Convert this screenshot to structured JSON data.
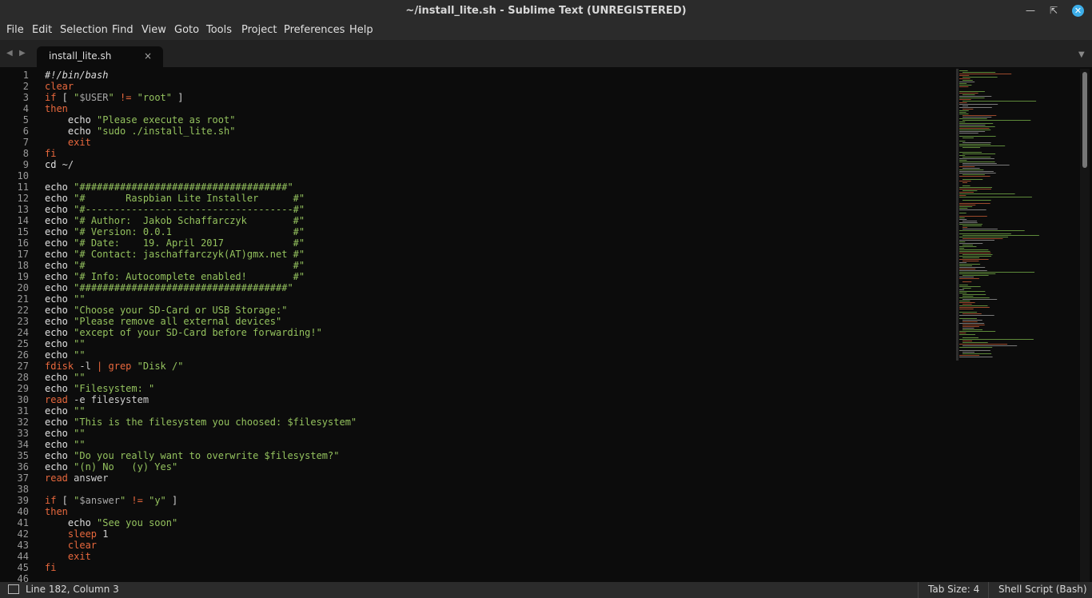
{
  "window": {
    "title": "~/install_lite.sh - Sublime Text (UNREGISTERED)",
    "minimize_icon": "minimize-icon",
    "restore_icon": "restore-icon",
    "close_icon": "close-icon"
  },
  "menu": [
    "File",
    "Edit",
    "Selection",
    "Find",
    "View",
    "Goto",
    "Tools",
    "Project",
    "Preferences",
    "Help"
  ],
  "tab": {
    "filename": "install_lite.sh",
    "close": "×"
  },
  "status": {
    "position": "Line 182, Column 3",
    "tab_size": "Tab Size: 4",
    "syntax": "Shell Script (Bash)"
  },
  "colors": {
    "keyword": "#e8683d",
    "string": "#94c25e",
    "background": "#0c0c0c",
    "chrome": "#2b2b2b",
    "accent": "#3daee9"
  },
  "code": [
    [
      [
        "i",
        "#!/bin/bash"
      ]
    ],
    [
      [
        "k",
        "clear"
      ]
    ],
    [
      [
        "k",
        "if"
      ],
      [
        "c",
        " [ "
      ],
      [
        "s",
        "\""
      ],
      [
        "v",
        "$USER"
      ],
      [
        "s",
        "\""
      ],
      [
        "c",
        " "
      ],
      [
        "k",
        "!="
      ],
      [
        "c",
        " "
      ],
      [
        "s",
        "\"root\""
      ],
      [
        "c",
        " ]"
      ]
    ],
    [
      [
        "k",
        "then"
      ]
    ],
    [
      [
        "c",
        "    "
      ],
      [
        "p",
        "echo"
      ],
      [
        "c",
        " "
      ],
      [
        "s",
        "\"Please execute as root\""
      ]
    ],
    [
      [
        "c",
        "    "
      ],
      [
        "p",
        "echo"
      ],
      [
        "c",
        " "
      ],
      [
        "s",
        "\"sudo ./install_lite.sh\""
      ]
    ],
    [
      [
        "c",
        "    "
      ],
      [
        "k",
        "exit"
      ]
    ],
    [
      [
        "k",
        "fi"
      ]
    ],
    [
      [
        "p",
        "cd"
      ],
      [
        "c",
        " ~/"
      ]
    ],
    [],
    [
      [
        "p",
        "echo"
      ],
      [
        "c",
        " "
      ],
      [
        "s",
        "\"####################################\""
      ]
    ],
    [
      [
        "p",
        "echo"
      ],
      [
        "c",
        " "
      ],
      [
        "s",
        "\"#       Raspbian Lite Installer      #\""
      ]
    ],
    [
      [
        "p",
        "echo"
      ],
      [
        "c",
        " "
      ],
      [
        "s",
        "\"#------------------------------------#\""
      ]
    ],
    [
      [
        "p",
        "echo"
      ],
      [
        "c",
        " "
      ],
      [
        "s",
        "\"# Author:  Jakob Schaffarczyk        #\""
      ]
    ],
    [
      [
        "p",
        "echo"
      ],
      [
        "c",
        " "
      ],
      [
        "s",
        "\"# Version: 0.0.1                     #\""
      ]
    ],
    [
      [
        "p",
        "echo"
      ],
      [
        "c",
        " "
      ],
      [
        "s",
        "\"# Date:    19. April 2017            #\""
      ]
    ],
    [
      [
        "p",
        "echo"
      ],
      [
        "c",
        " "
      ],
      [
        "s",
        "\"# Contact: jaschaffarczyk(AT)gmx.net #\""
      ]
    ],
    [
      [
        "p",
        "echo"
      ],
      [
        "c",
        " "
      ],
      [
        "s",
        "\"#                                    #\""
      ]
    ],
    [
      [
        "p",
        "echo"
      ],
      [
        "c",
        " "
      ],
      [
        "s",
        "\"# Info: Autocomplete enabled!        #\""
      ]
    ],
    [
      [
        "p",
        "echo"
      ],
      [
        "c",
        " "
      ],
      [
        "s",
        "\"####################################\""
      ]
    ],
    [
      [
        "p",
        "echo"
      ],
      [
        "c",
        " "
      ],
      [
        "s",
        "\"\""
      ]
    ],
    [
      [
        "p",
        "echo"
      ],
      [
        "c",
        " "
      ],
      [
        "s",
        "\"Choose your SD-Card or USB Storage:\""
      ]
    ],
    [
      [
        "p",
        "echo"
      ],
      [
        "c",
        " "
      ],
      [
        "s",
        "\"Please remove all external devices\""
      ]
    ],
    [
      [
        "p",
        "echo"
      ],
      [
        "c",
        " "
      ],
      [
        "s",
        "\"except of your SD-Card before forwarding!\""
      ]
    ],
    [
      [
        "p",
        "echo"
      ],
      [
        "c",
        " "
      ],
      [
        "s",
        "\"\""
      ]
    ],
    [
      [
        "p",
        "echo"
      ],
      [
        "c",
        " "
      ],
      [
        "s",
        "\"\""
      ]
    ],
    [
      [
        "k",
        "fdisk"
      ],
      [
        "c",
        " -l "
      ],
      [
        "k",
        "|"
      ],
      [
        "c",
        " "
      ],
      [
        "k",
        "grep"
      ],
      [
        "c",
        " "
      ],
      [
        "s",
        "\"Disk /\""
      ]
    ],
    [
      [
        "p",
        "echo"
      ],
      [
        "c",
        " "
      ],
      [
        "s",
        "\"\""
      ]
    ],
    [
      [
        "p",
        "echo"
      ],
      [
        "c",
        " "
      ],
      [
        "s",
        "\"Filesystem: \""
      ]
    ],
    [
      [
        "k",
        "read"
      ],
      [
        "c",
        " -e filesystem"
      ]
    ],
    [
      [
        "p",
        "echo"
      ],
      [
        "c",
        " "
      ],
      [
        "s",
        "\"\""
      ]
    ],
    [
      [
        "p",
        "echo"
      ],
      [
        "c",
        " "
      ],
      [
        "s",
        "\"This is the filesystem you choosed: $filesystem\""
      ]
    ],
    [
      [
        "p",
        "echo"
      ],
      [
        "c",
        " "
      ],
      [
        "s",
        "\"\""
      ]
    ],
    [
      [
        "p",
        "echo"
      ],
      [
        "c",
        " "
      ],
      [
        "s",
        "\"\""
      ]
    ],
    [
      [
        "p",
        "echo"
      ],
      [
        "c",
        " "
      ],
      [
        "s",
        "\"Do you really want to overwrite $filesystem?\""
      ]
    ],
    [
      [
        "p",
        "echo"
      ],
      [
        "c",
        " "
      ],
      [
        "s",
        "\"(n) No   (y) Yes\""
      ]
    ],
    [
      [
        "k",
        "read"
      ],
      [
        "c",
        " answer"
      ]
    ],
    [],
    [
      [
        "k",
        "if"
      ],
      [
        "c",
        " [ "
      ],
      [
        "s",
        "\""
      ],
      [
        "v",
        "$answer"
      ],
      [
        "s",
        "\""
      ],
      [
        "c",
        " "
      ],
      [
        "k",
        "!="
      ],
      [
        "c",
        " "
      ],
      [
        "s",
        "\"y\""
      ],
      [
        "c",
        " ]"
      ]
    ],
    [
      [
        "k",
        "then"
      ]
    ],
    [
      [
        "c",
        "    "
      ],
      [
        "p",
        "echo"
      ],
      [
        "c",
        " "
      ],
      [
        "s",
        "\"See you soon\""
      ]
    ],
    [
      [
        "c",
        "    "
      ],
      [
        "k",
        "sleep"
      ],
      [
        "c",
        " 1"
      ]
    ],
    [
      [
        "c",
        "    "
      ],
      [
        "k",
        "clear"
      ]
    ],
    [
      [
        "c",
        "    "
      ],
      [
        "k",
        "exit"
      ]
    ],
    [
      [
        "k",
        "fi"
      ]
    ],
    []
  ]
}
